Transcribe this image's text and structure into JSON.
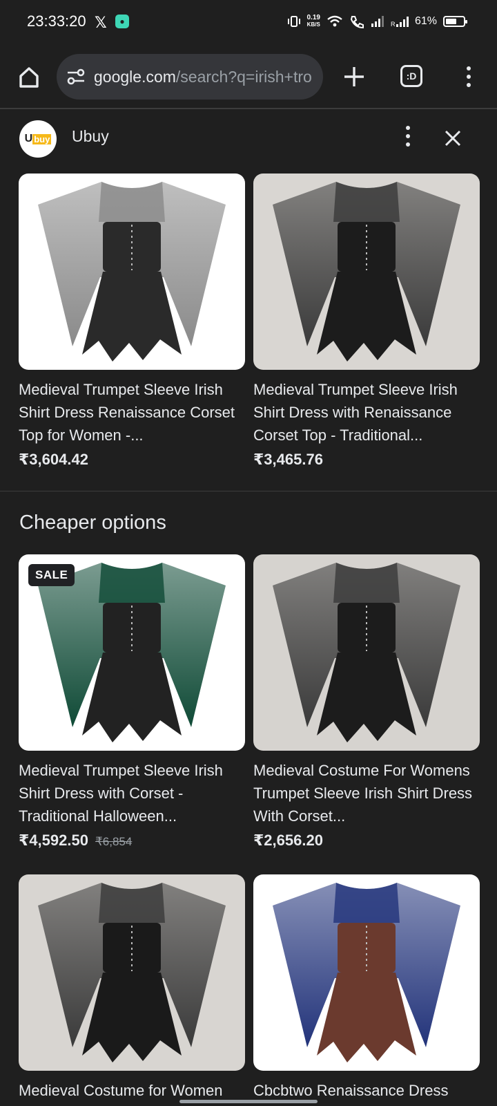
{
  "status_bar": {
    "time": "23:33:20",
    "net_speed_value": "0.19",
    "net_speed_unit": "KB/S",
    "battery_percent": "61%",
    "battery_level": 0.61
  },
  "toolbar": {
    "url_host": "google.com",
    "url_path": "/search?q=irish+tro",
    "tab_count_label": ":D"
  },
  "source": {
    "name": "Ubuy",
    "logo_text": "U",
    "logo_badge": "buy"
  },
  "products": [
    {
      "title": "Medieval Trumpet Sleeve Irish Shirt Dress Renaissance Corset Top for Women -...",
      "price": "₹3,604.42",
      "old_price": "",
      "sale": false,
      "sleeve_color": "#8a8a8a",
      "bodice_color": "#2a2a2a",
      "bg_color": "#ffffff"
    },
    {
      "title": "Medieval Trumpet Sleeve Irish Shirt Dress with Renaissance Corset Top - Traditional...",
      "price": "₹3,465.76",
      "old_price": "",
      "sale": false,
      "sleeve_color": "#3a3a3a",
      "bodice_color": "#1c1c1c",
      "bg_color": "#d9d6d2"
    }
  ],
  "cheaper_section": {
    "heading": "Cheaper options",
    "items": [
      {
        "title": "Medieval Trumpet Sleeve Irish Shirt Dress with Corset - Traditional Halloween...",
        "price": "₹4,592.50",
        "old_price": "₹6,854",
        "sale": true,
        "sale_label": "SALE",
        "sleeve_color": "#0f4a36",
        "bodice_color": "#222222",
        "bg_color": "#ffffff"
      },
      {
        "title": "Medieval Costume For Womens Trumpet Sleeve Irish Shirt Dress With Corset...",
        "price": "₹2,656.20",
        "old_price": "",
        "sale": false,
        "sleeve_color": "#3a3a3a",
        "bodice_color": "#1c1c1c",
        "bg_color": "#d6d3cf"
      },
      {
        "title": "Medieval Costume for Women Trumpet Sleeve Irish",
        "price": "",
        "old_price": "",
        "sale": false,
        "sleeve_color": "#3a3a3a",
        "bodice_color": "#1a1a1a",
        "bg_color": "#d8d5d1"
      },
      {
        "title": "Cbcbtwo Renaissance Dress Women Fairy Elf With Corset",
        "price": "",
        "old_price": "",
        "sale": false,
        "sleeve_color": "#22337a",
        "bodice_color": "#6b3a2e",
        "bg_color": "#ffffff"
      }
    ]
  }
}
